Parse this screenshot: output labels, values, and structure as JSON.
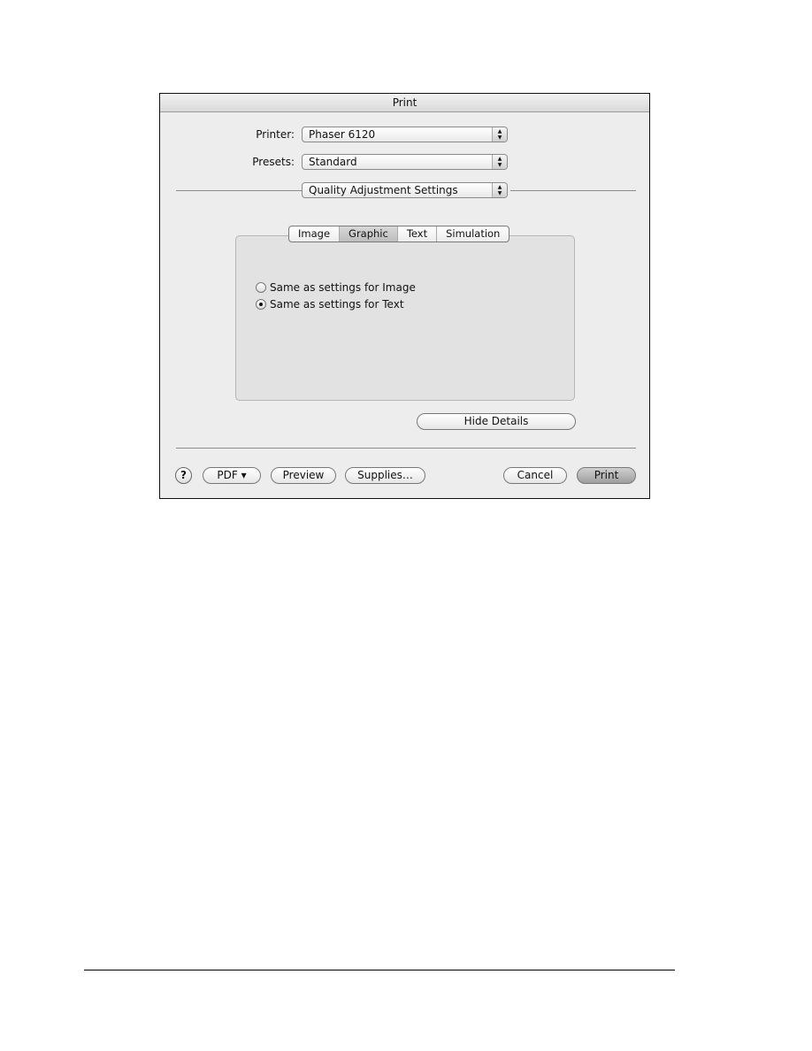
{
  "dialog": {
    "title": "Print",
    "printer": {
      "label": "Printer:",
      "value": "Phaser 6120"
    },
    "presets": {
      "label": "Presets:",
      "value": "Standard"
    },
    "panel_select": {
      "value": "Quality Adjustment Settings"
    },
    "tabs": [
      {
        "label": "Image",
        "selected": false
      },
      {
        "label": "Graphic",
        "selected": true
      },
      {
        "label": "Text",
        "selected": false
      },
      {
        "label": "Simulation",
        "selected": false
      }
    ],
    "options": [
      {
        "label": "Same as settings for Image",
        "selected": false
      },
      {
        "label": "Same as settings for Text",
        "selected": true
      }
    ],
    "hide_details_label": "Hide Details",
    "footer": {
      "help_label": "?",
      "pdf_label": "PDF ▾",
      "preview_label": "Preview",
      "supplies_label": "Supplies…",
      "cancel_label": "Cancel",
      "print_label": "Print"
    },
    "popup_arrow": "▲▼"
  }
}
